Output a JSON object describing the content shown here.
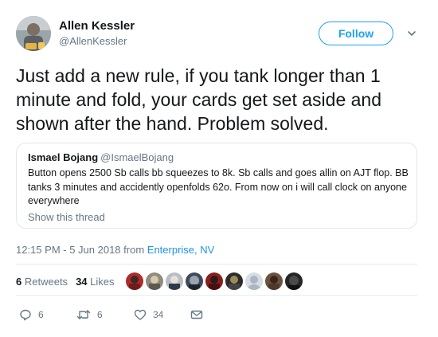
{
  "author": {
    "name": "Allen Kessler",
    "handle": "@AllenKessler"
  },
  "follow_label": "Follow",
  "tweet_text": "Just add a new rule, if you tank longer than 1 minute and fold, your cards get set aside and shown after the hand. Problem solved.",
  "quoted": {
    "name": "Ismael Bojang",
    "handle": "@IsmaelBojang",
    "text": "Button opens 2500 Sb calls bb squeezes to 8k. Sb calls and goes allin on AJT flop. BB tanks 3 minutes and accidently openfolds 62o. From now on i will call clock on anyone everywhere",
    "show_thread": "Show this thread"
  },
  "timestamp": "12:15 PM - 5 Jun 2018 from",
  "location": "Enterprise, NV",
  "stats": {
    "retweets_count": "6",
    "retweets_label": "Retweets",
    "likes_count": "34",
    "likes_label": "Likes"
  },
  "actions": {
    "reply_count": "6",
    "retweet_count": "6",
    "like_count": "34"
  },
  "icons": [
    "chevron-down-icon",
    "reply-icon",
    "retweet-icon",
    "heart-icon",
    "message-icon"
  ],
  "colors": {
    "accent": "#1da1f2",
    "link": "#1b95e0",
    "text": "#14171a",
    "muted": "#657786",
    "border": "#e1e8ed"
  }
}
